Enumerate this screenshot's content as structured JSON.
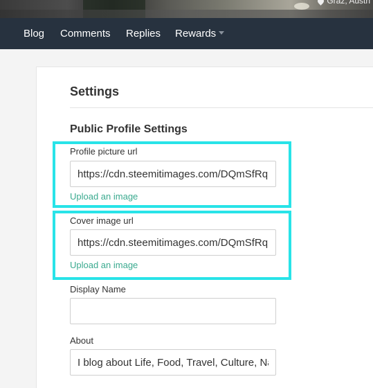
{
  "cover": {
    "location": "Graz, Austri"
  },
  "nav": {
    "items": [
      {
        "label": "Blog"
      },
      {
        "label": "Comments"
      },
      {
        "label": "Replies"
      },
      {
        "label": "Rewards"
      }
    ]
  },
  "settings": {
    "title": "Settings",
    "section_title": "Public Profile Settings",
    "profile_picture": {
      "label": "Profile picture url",
      "value": "https://cdn.steemitimages.com/DQmSfRq",
      "upload_label": "Upload an image"
    },
    "cover_image": {
      "label": "Cover image url",
      "value": "https://cdn.steemitimages.com/DQmSfRq",
      "upload_label": "Upload an image"
    },
    "display_name": {
      "label": "Display Name",
      "value": ""
    },
    "about": {
      "label": "About",
      "value": "I blog about Life, Food, Travel, Culture, Nature"
    }
  },
  "colors": {
    "nav_background": "#27323f",
    "link": "#3aaa8f",
    "highlight": "#28e3e8"
  }
}
